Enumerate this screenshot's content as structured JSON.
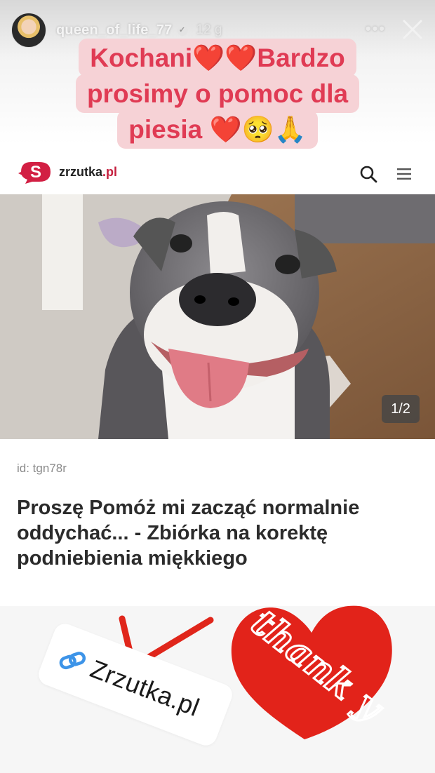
{
  "story": {
    "progress": [
      1.0,
      0.35,
      0.0,
      0.0
    ],
    "user": {
      "username": "queen_of_life_77",
      "time_ago": "12 g"
    },
    "sticker_text": {
      "line1": "Kochani❤️❤️Bardzo",
      "line2": "prosimy o pomoc dla",
      "line3": "piesia ❤️🥺🙏"
    }
  },
  "site": {
    "logo_text_main": "zrzutka",
    "logo_text_suffix": ".pl",
    "photo_counter": "1/2",
    "campaign_id": "id: tgn78r",
    "campaign_title": "Proszę Pomóż mi zacząć normalnie oddychać... - Zbiórka na korektę podniebienia miękkiego"
  },
  "link_sticker": {
    "label": "Zrzutka.pl"
  },
  "thank_sticker": {
    "text": "thank y"
  },
  "colors": {
    "accent": "#e03b54",
    "brand": "#c5203f",
    "sticker_bg": "#f6d2d6",
    "arrow": "#e0261b",
    "heart": "#e2231a"
  },
  "icons": [
    "verified-icon",
    "more-icon",
    "close-icon",
    "search-icon",
    "menu-icon",
    "link-icon",
    "arrow-icon",
    "heart-icon"
  ]
}
